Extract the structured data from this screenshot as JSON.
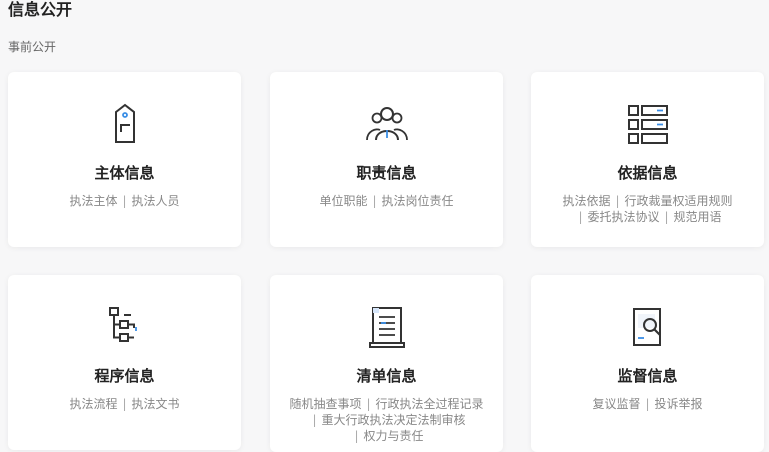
{
  "page": {
    "title": "信息公开",
    "section_label": "事前公开"
  },
  "cards": [
    {
      "title": "主体信息",
      "icon": "tag-icon",
      "links": [
        "执法主体",
        "执法人员"
      ]
    },
    {
      "title": "职责信息",
      "icon": "people-icon",
      "links": [
        "单位职能",
        "执法岗位责任"
      ]
    },
    {
      "title": "依据信息",
      "icon": "list-icon",
      "links": [
        "执法依据",
        "行政裁量权适用规则",
        "委托执法协议",
        "规范用语"
      ]
    },
    {
      "title": "程序信息",
      "icon": "flow-tree-icon",
      "links": [
        "执法流程",
        "执法文书"
      ]
    },
    {
      "title": "清单信息",
      "icon": "clipboard-list-icon",
      "links": [
        "随机抽查事项",
        "行政执法全过程记录",
        "重大行政执法决定法制审核",
        "权力与责任"
      ]
    },
    {
      "title": "监督信息",
      "icon": "document-search-icon",
      "links": [
        "复议监督",
        "投诉举报"
      ]
    }
  ],
  "colors": {
    "accent": "#3a8ee6",
    "icon_stroke": "#333333"
  }
}
